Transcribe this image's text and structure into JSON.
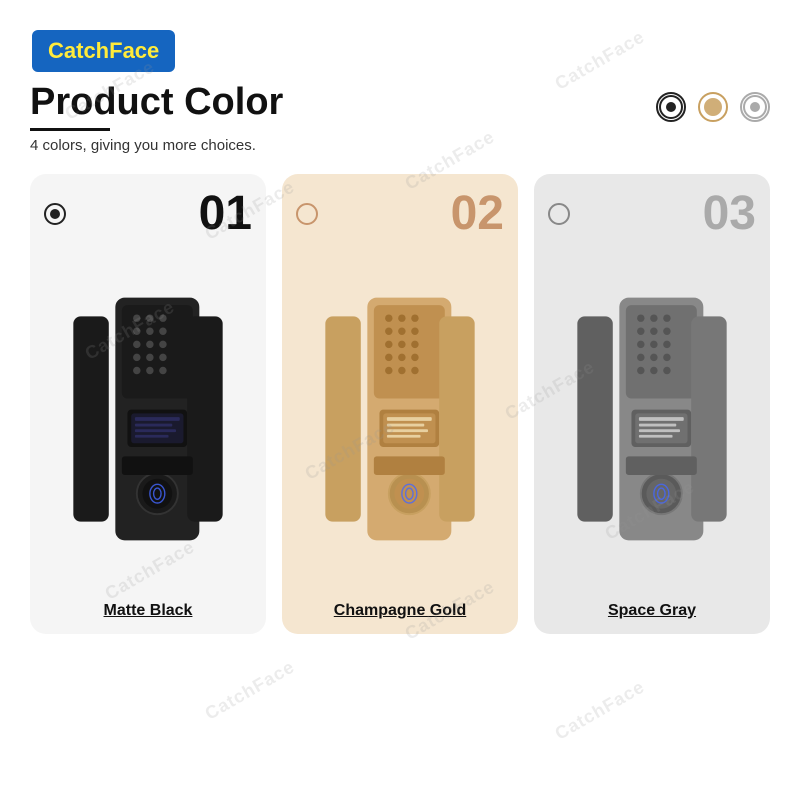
{
  "brand": {
    "name_part1": "Catch",
    "name_part2": "Face"
  },
  "section": {
    "title": "Product Color",
    "subtitle": "4 colors, giving you more choices."
  },
  "color_selector": {
    "dots": [
      {
        "id": "black-dot",
        "color": "#222222",
        "selected": true
      },
      {
        "id": "gold-dot",
        "color": "#c8a060",
        "selected": false
      },
      {
        "id": "gray-dot",
        "color": "#aaaaaa",
        "selected": false
      }
    ]
  },
  "cards": [
    {
      "id": "card-1",
      "number": "01",
      "label": "Matte Black",
      "bg_color": "#f2f2f2",
      "number_color": "#111111",
      "lock_color_main": "#1a1a1a",
      "lock_color_side": "#2a2a2a",
      "selected": true
    },
    {
      "id": "card-2",
      "number": "02",
      "label": "Champagne Gold",
      "bg_color": "#f5e6d0",
      "number_color": "#c8956c",
      "lock_color_main": "#c8a060",
      "lock_color_side": "#b8904a",
      "selected": false
    },
    {
      "id": "card-3",
      "number": "03",
      "label": "Space Gray",
      "bg_color": "#e4e4e4",
      "number_color": "#aaaaaa",
      "lock_color_main": "#888888",
      "lock_color_side": "#999999",
      "selected": false
    }
  ]
}
